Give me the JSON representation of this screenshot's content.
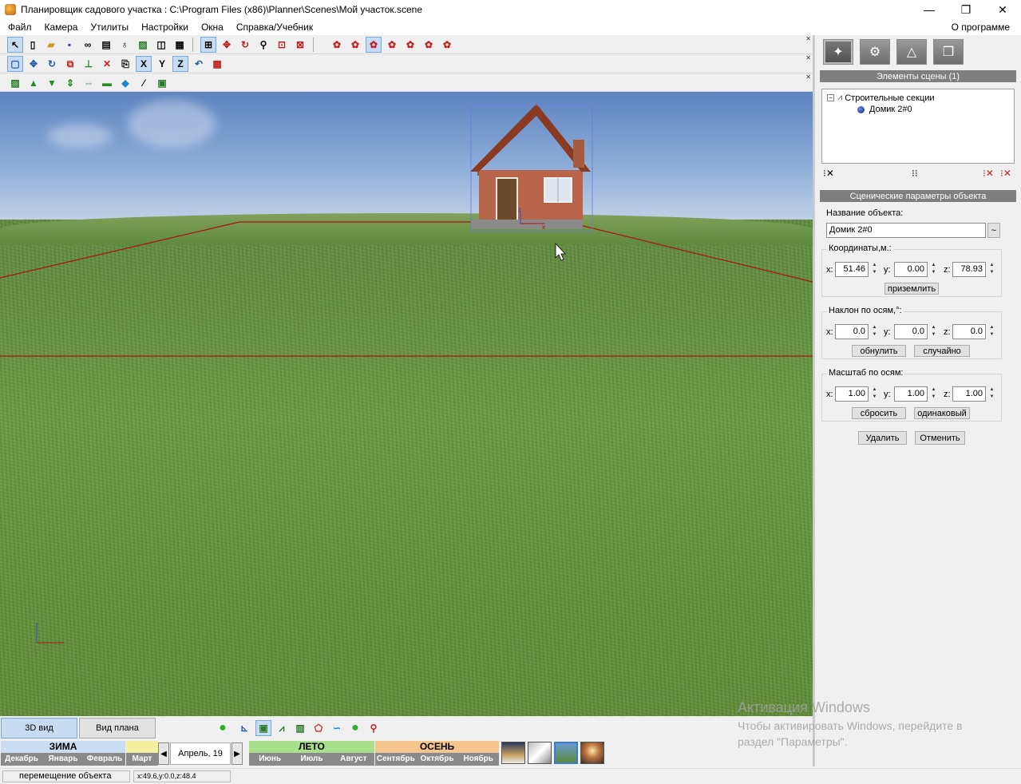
{
  "window": {
    "title": "Планировщик садового участка : C:\\Program Files (x86)\\Planner\\Scenes\\Мой участок.scene",
    "minimize": "—",
    "maximize": "❐",
    "close": "✕"
  },
  "menu": {
    "items": [
      "Файл",
      "Камера",
      "Утилиты",
      "Настройки",
      "Окна",
      "Справка/Учебник"
    ],
    "about": "О программе"
  },
  "toolbar2": {
    "x": "X",
    "y": "Y",
    "z": "Z"
  },
  "panel": {
    "scene_elements_header": "Элементы сцены (1)",
    "tree": {
      "group": "Строительные секции",
      "item": "Домик 2#0"
    },
    "params_header": "Сценические параметры объекта",
    "name_label": "Название объекта:",
    "name_value": "Домик 2#0",
    "coords_label": "Координаты,м.:",
    "coords": {
      "x": "51.46",
      "y": "0.00",
      "z": "78.93"
    },
    "ground_button": "приземлить",
    "tilt_label": "Наклон по осям,°:",
    "tilt": {
      "x": "0.0",
      "y": "0.0",
      "z": "0.0"
    },
    "reset_tilt_button": "обнулить",
    "random_button": "случайно",
    "scale_label": "Масштаб по осям:",
    "scale": {
      "x": "1.00",
      "y": "1.00",
      "z": "1.00"
    },
    "reset_scale_button": "сбросить",
    "uniform_button": "одинаковый",
    "delete_button": "Удалить",
    "cancel_button": "Отменить",
    "axis_x": "x:",
    "axis_y": "y:",
    "axis_z": "z:"
  },
  "view_tabs": {
    "view3d": "3D вид",
    "plan": "Вид плана"
  },
  "seasons": {
    "winter": {
      "name": "ЗИМА",
      "months": [
        "Декабрь",
        "Январь",
        "Февраль"
      ],
      "color": "#c9def4"
    },
    "march": "Март",
    "date": "Апрель, 19",
    "summer": {
      "name": "ЛЕТО",
      "months": [
        "Июнь",
        "Июль",
        "Август"
      ],
      "color": "#a8e08c"
    },
    "autumn": {
      "name": "ОСЕНЬ",
      "months": [
        "Сентябрь",
        "Октябрь",
        "Ноябрь"
      ],
      "color": "#f5c58e"
    }
  },
  "status": {
    "mode": "перемещение объекта",
    "coords": "x:49.6,y:0.0,z:48.4"
  },
  "watermark": {
    "line1": "Активация Windows",
    "line2": "Чтобы активировать Windows, перейдите в",
    "line3": "раздел \"Параметры\"."
  },
  "scene": {
    "axis_x": "x",
    "axis_z": "z"
  }
}
